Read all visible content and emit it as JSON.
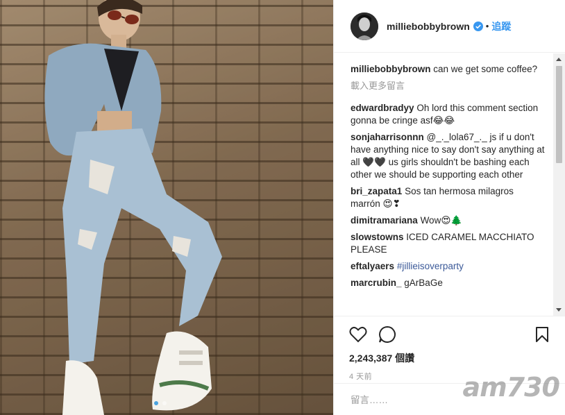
{
  "post": {
    "username": "milliebobbybrown",
    "follow_label": "追蹤",
    "dot": "•"
  },
  "comments": [
    {
      "user": "milliebobbybrown",
      "text": "can we get some coffee?"
    }
  ],
  "load_more": "載入更多留言",
  "replies": [
    {
      "user": "edwardbradyy",
      "text": "Oh lord this comment section gonna be cringe asf😂😂"
    },
    {
      "user": "sonjaharrisonnn",
      "text": "@_._lola67_._ js if u don't have anything nice to say don't say anything at all 🖤🖤 us girls shouldn't be bashing each other we should be supporting each other"
    },
    {
      "user": "bri_zapata1",
      "text": "Sos tan hermosa milagros marrón 😍❣"
    },
    {
      "user": "dimitramariana",
      "text": "Wow😍🌲"
    },
    {
      "user": "slowstowns",
      "text": "ICED CARAMEL MACCHIATO PLEASE"
    },
    {
      "user": "eftalyaers",
      "text": "",
      "hashtag": "#jillieisoverparty"
    },
    {
      "user": "marcrubin_",
      "text": "gArBaGe"
    }
  ],
  "likes": "2,243,387 個讚",
  "time": "4 天前",
  "add_comment_placeholder": "留言……",
  "watermark": "am730",
  "icons": {
    "like": "heart-icon",
    "comment": "comment-icon",
    "save": "bookmark-icon",
    "verified": "verified-badge-icon"
  },
  "colors": {
    "follow": "#3897f0",
    "hashtag": "#3b5998",
    "muted": "#999999"
  }
}
